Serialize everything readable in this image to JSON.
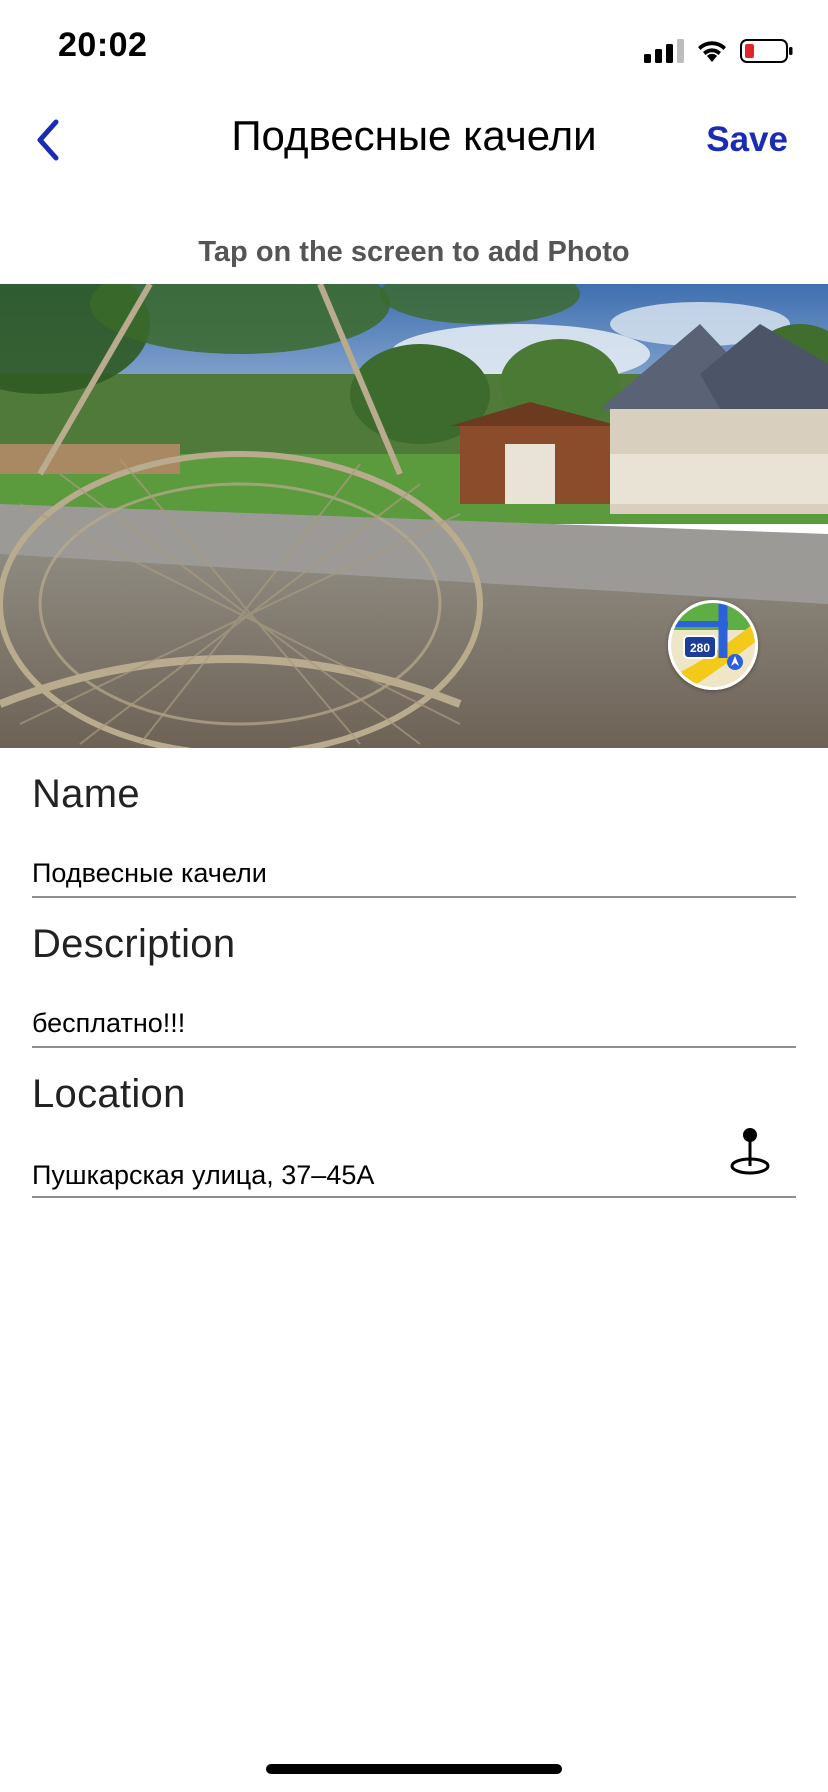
{
  "status_bar": {
    "time": "20:02",
    "signal_icon": "cellular-signal-icon",
    "wifi_icon": "wifi-icon",
    "battery_icon": "battery-low-icon"
  },
  "nav": {
    "back_icon": "chevron-left-icon",
    "title": "Подвесные качели",
    "save_label": "Save",
    "accent_color": "#1a2bb5"
  },
  "photo": {
    "hint": "Tap on the screen to add Photo",
    "maps_badge_text": "280",
    "maps_icon": "apple-maps-icon"
  },
  "form": {
    "name": {
      "label": "Name",
      "value": "Подвесные качели"
    },
    "description": {
      "label": "Description",
      "value": "бесплатно!!!"
    },
    "location": {
      "label": "Location",
      "value": "Пушкарская улица, 37–45А",
      "pin_icon": "map-pin-icon"
    }
  }
}
